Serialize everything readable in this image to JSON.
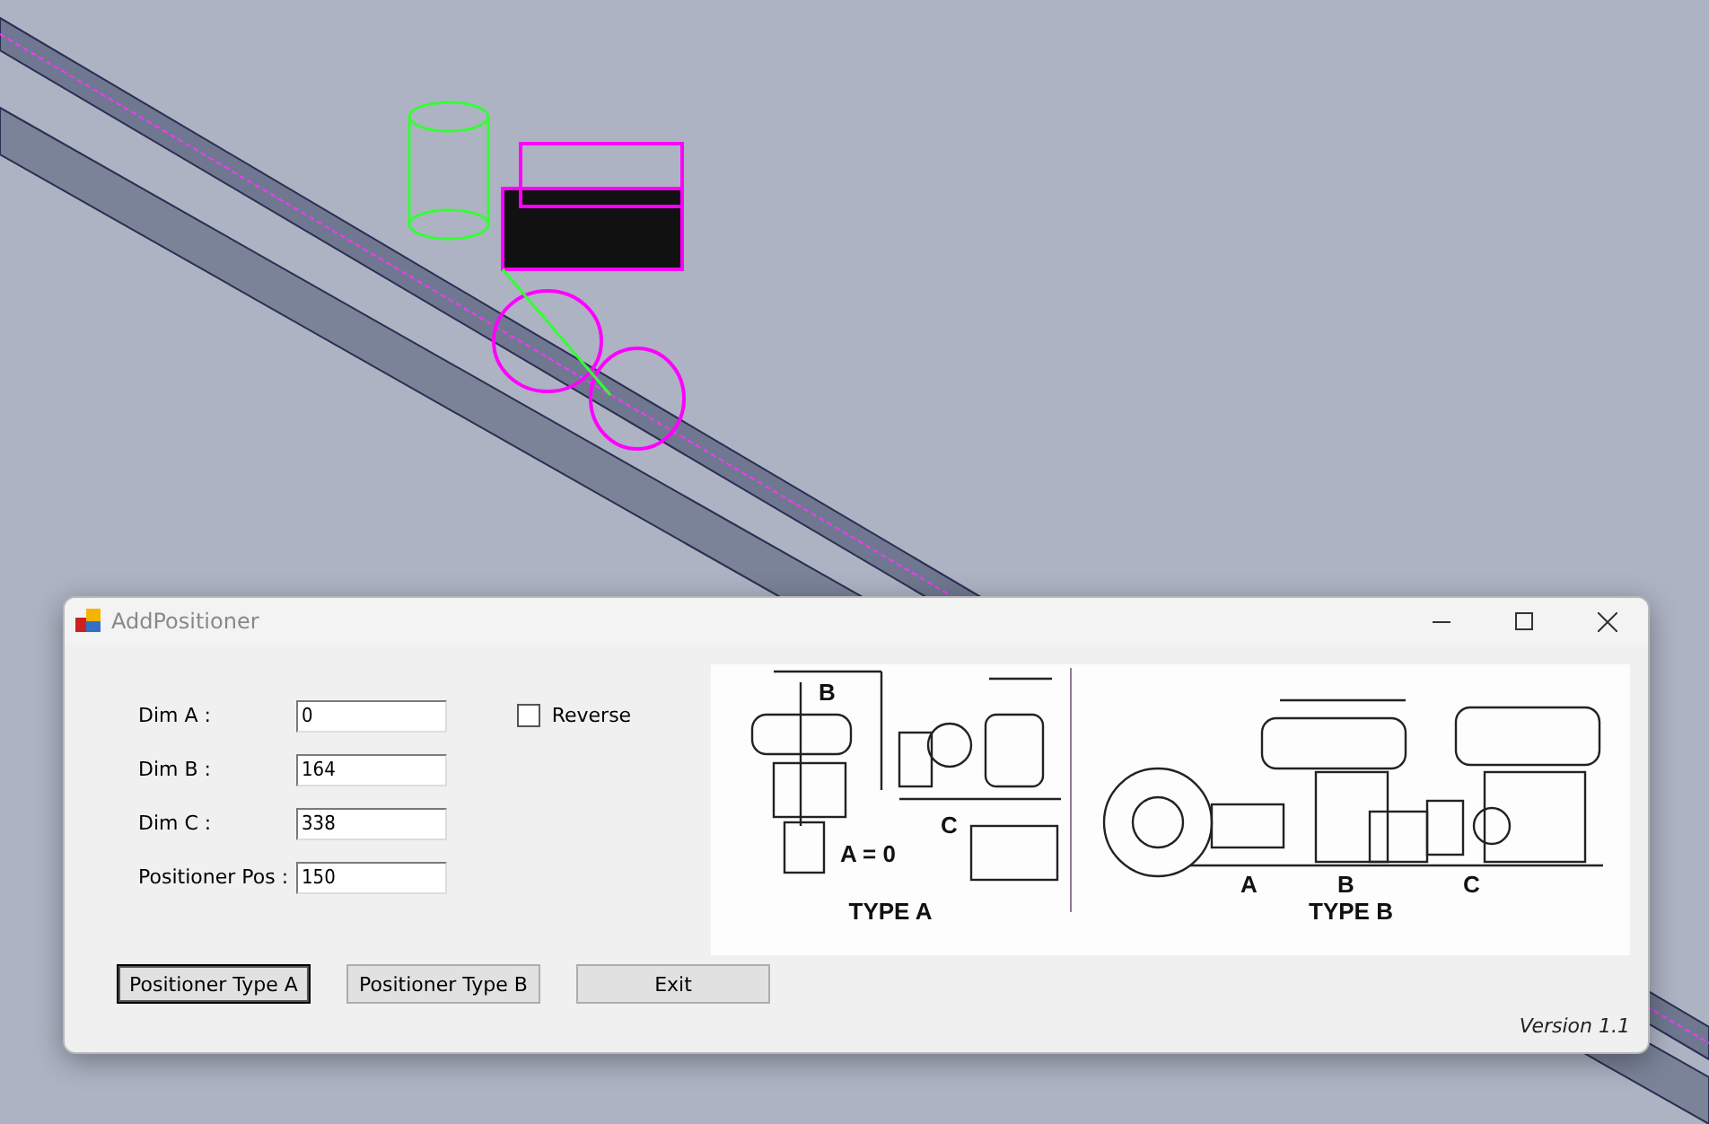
{
  "window": {
    "title": "AddPositioner"
  },
  "fields": [
    {
      "label": "Dim A :",
      "value": "0"
    },
    {
      "label": "Dim B :",
      "value": "164"
    },
    {
      "label": "Dim C :",
      "value": "338"
    },
    {
      "label": "Positioner Pos :",
      "value": "150"
    }
  ],
  "reverse": {
    "label": "Reverse",
    "checked": false
  },
  "diagram": {
    "type_a": {
      "caption": "TYPE A",
      "labels": [
        "B",
        "C",
        "A = 0"
      ]
    },
    "type_b": {
      "caption": "TYPE B",
      "labels": [
        "A",
        "B",
        "C"
      ]
    }
  },
  "buttons": [
    {
      "label": "Positioner Type A",
      "selected": true
    },
    {
      "label": "Positioner Type B",
      "selected": false
    },
    {
      "label": "Exit",
      "selected": false
    }
  ],
  "version": "Version 1.1"
}
